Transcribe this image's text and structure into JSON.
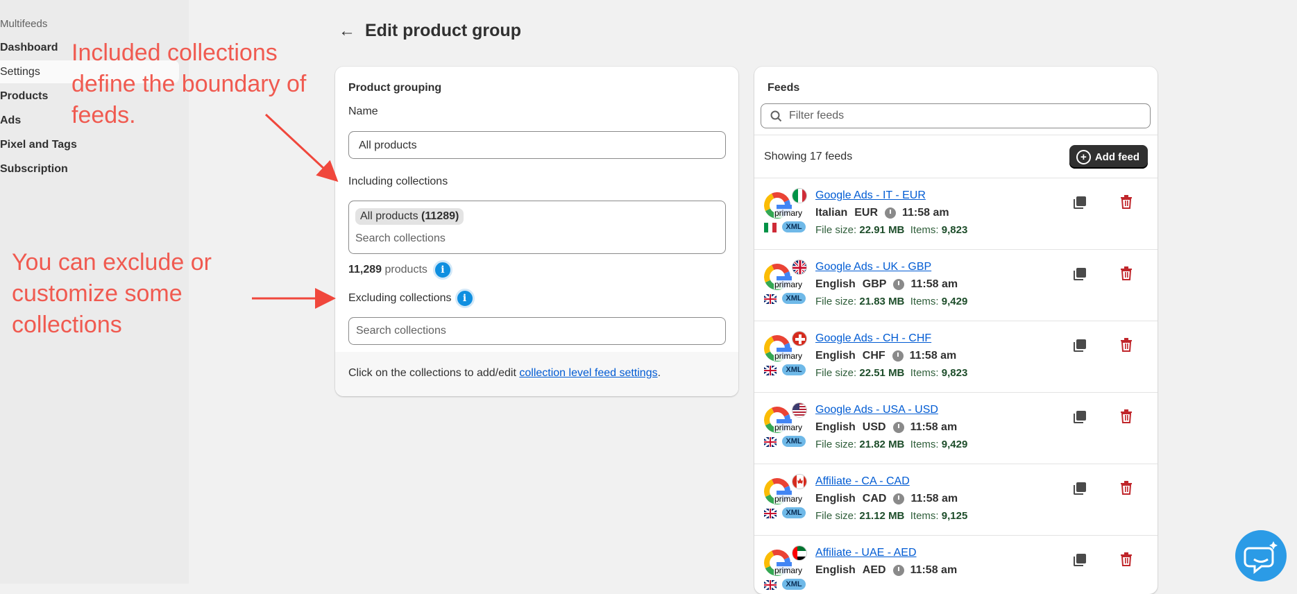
{
  "sidebar": {
    "app_name": "Multifeeds",
    "items": [
      {
        "label": "Dashboard"
      },
      {
        "label": "Settings"
      },
      {
        "label": "Products"
      },
      {
        "label": "Ads"
      },
      {
        "label": "Pixel and Tags"
      },
      {
        "label": "Subscription"
      }
    ]
  },
  "header": {
    "back_icon": "arrow-left-icon",
    "title": "Edit product group"
  },
  "grouping": {
    "heading": "Product grouping",
    "name_label": "Name",
    "name_value": "All products",
    "including_label": "Including collections",
    "included_chip_name": "All products",
    "included_chip_count": "(11289)",
    "search_placeholder": "Search collections",
    "product_count": "11,289",
    "product_count_suffix": "products",
    "excluding_label": "Excluding collections",
    "footer_prefix": "Click on the collections to add/edit",
    "footer_link": "collection level feed settings",
    "footer_suffix": "."
  },
  "feeds": {
    "heading": "Feeds",
    "filter_placeholder": "Filter feeds",
    "showing_text": "Showing 17 feeds",
    "add_label": "Add feed",
    "primary_label": "primary",
    "xml_label": "XML",
    "file_size_label": "File size:",
    "items_label": "Items:",
    "items": [
      {
        "name": "Google Ads - IT - EUR",
        "language": "Italian",
        "currency": "EUR",
        "time": "11:58 am",
        "file_size": "22.91 MB",
        "count": "9,823",
        "flag": "IT"
      },
      {
        "name": "Google Ads - UK - GBP",
        "language": "English",
        "currency": "GBP",
        "time": "11:58 am",
        "file_size": "21.83 MB",
        "count": "9,429",
        "flag": "UK"
      },
      {
        "name": "Google Ads - CH - CHF",
        "language": "English",
        "currency": "CHF",
        "time": "11:58 am",
        "file_size": "22.51 MB",
        "count": "9,823",
        "flag": "CH"
      },
      {
        "name": "Google Ads - USA - USD",
        "language": "English",
        "currency": "USD",
        "time": "11:58 am",
        "file_size": "21.82 MB",
        "count": "9,429",
        "flag": "US"
      },
      {
        "name": "Affiliate - CA - CAD",
        "language": "English",
        "currency": "CAD",
        "time": "11:58 am",
        "file_size": "21.12 MB",
        "count": "9,125",
        "flag": "CA"
      },
      {
        "name": "Affiliate - UAE - AED",
        "language": "English",
        "currency": "AED",
        "time": "11:58 am",
        "file_size": "",
        "count": "",
        "flag": "AE"
      }
    ]
  },
  "annotations": {
    "top": [
      "Included collections",
      "define the boundary of",
      "feeds."
    ],
    "bottom": [
      "You can exclude or",
      "customize some",
      "collections"
    ],
    "color": "#f05a50"
  },
  "colors": {
    "link": "#005bd3",
    "accent_dark": "#303030",
    "info": "#0f8fe0",
    "delete": "#c0262b"
  }
}
